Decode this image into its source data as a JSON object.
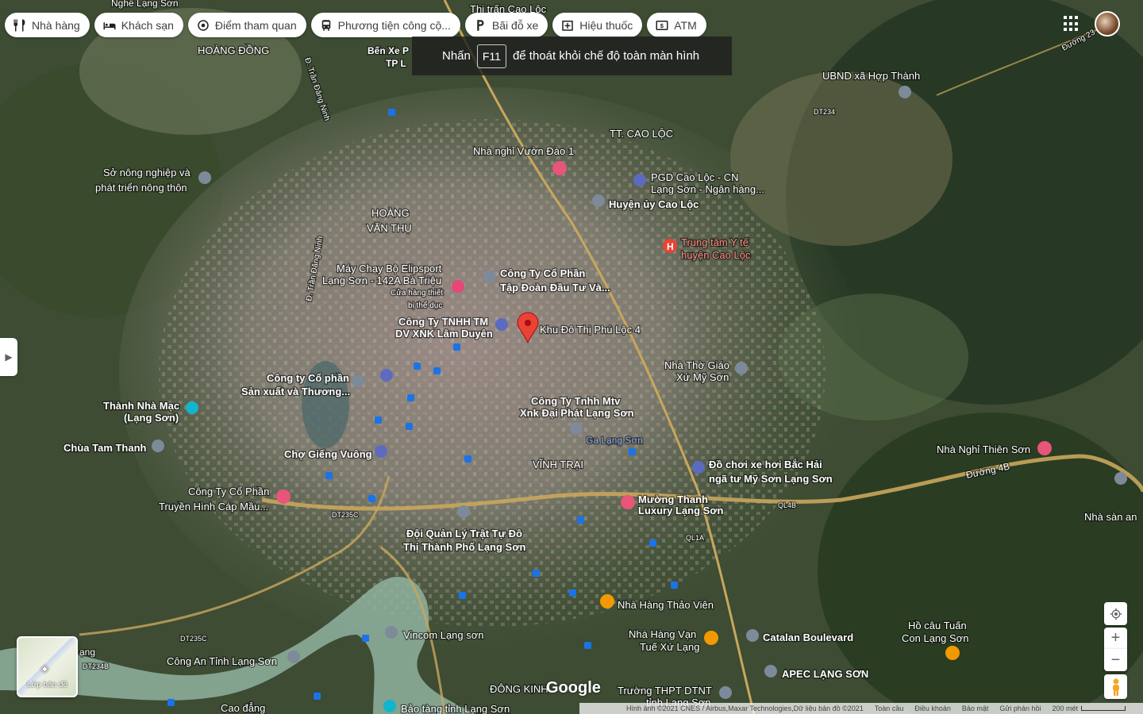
{
  "chips": [
    {
      "label": "Nhà hàng",
      "icon": "restaurant-icon"
    },
    {
      "label": "Khách sạn",
      "icon": "hotel-icon"
    },
    {
      "label": "Điểm tham quan",
      "icon": "attraction-icon"
    },
    {
      "label": "Phương tiện công cộ...",
      "icon": "transit-icon"
    },
    {
      "label": "Bãi đỗ xe",
      "icon": "parking-icon"
    },
    {
      "label": "Hiệu thuốc",
      "icon": "pharmacy-icon"
    },
    {
      "label": "ATM",
      "icon": "atm-icon"
    }
  ],
  "fullscreen_notice": {
    "prefix": "Nhấn",
    "key": "F11",
    "suffix": "để thoát khỏi chế độ toàn màn hình"
  },
  "layers_button": {
    "label": "Lớp bản đồ"
  },
  "footer": {
    "imagery": "Hình ảnh ©2021 CNES / Airbus,Maxar Technologies,Dữ liệu bản đồ ©2021",
    "global": "Toàn cầu",
    "terms": "Điều khoản",
    "privacy": "Bảo mật",
    "feedback": "Gửi phản hồi",
    "scale": "200 mét"
  },
  "brand": "Google",
  "colors": {
    "road_major": "#c9a65c",
    "river": "#8fb3a0",
    "pin_red": "#ea4335",
    "hotel_pink": "#e8557a",
    "food_orange": "#f29900",
    "poi_gray": "#7c8a9a",
    "transit_blue": "#1a73e8",
    "poi_teal": "#12b5cb"
  },
  "map_labels": [
    {
      "text": "Nghề Lạng Sơn",
      "kind": "area"
    },
    {
      "text": "Thị trấn Cao Lộc",
      "kind": "area"
    },
    {
      "text": "HOÀNG ĐỒNG",
      "kind": "district"
    },
    {
      "text": "Bến Xe Phía Bắc TP Lạng Sơn",
      "kind": "place"
    },
    {
      "text": "Đường 23",
      "kind": "road"
    },
    {
      "text": "UBND xã Hợp Thành",
      "kind": "place"
    },
    {
      "text": "DT234",
      "kind": "shield"
    },
    {
      "text": "TT. CAO LỘC",
      "kind": "district"
    },
    {
      "text": "Nhà nghỉ Vườn Đào 1",
      "kind": "hotel"
    },
    {
      "text": "Sở nông nghiệp và phát triển nông thôn",
      "kind": "place"
    },
    {
      "text": "PGD Cao Lộc - CN Lạng Sơn - Ngân hàng...",
      "kind": "place"
    },
    {
      "text": "Huyện ủy Cao Lộc",
      "kind": "place"
    },
    {
      "text": "HOÀNG VĂN THỤ",
      "kind": "district"
    },
    {
      "text": "Trung tâm Y tế huyện Cao Lộc",
      "kind": "hospital"
    },
    {
      "text": "Máy Chạy Bộ Elipsport Lạng Sơn - 142A Bà Triệu",
      "kind": "place"
    },
    {
      "text": "Cửa hàng thiết bị thể dục",
      "kind": "small"
    },
    {
      "text": "Công Ty Cổ Phần Tập Đoàn Đầu Tư Và...",
      "kind": "place"
    },
    {
      "text": "Công Ty TNHH TM DV XNK Lâm Duyên",
      "kind": "place"
    },
    {
      "text": "Khu Đô Thị Phú Lộc 4",
      "kind": "selected"
    },
    {
      "text": "Nhà Thờ Giáo Xứ Mỹ Sơn",
      "kind": "place"
    },
    {
      "text": "Công ty Cổ phần Sản xuất và Thương...",
      "kind": "place"
    },
    {
      "text": "Công Ty Tnhh Mtv Xnk Đại Phát Lạng Sơn",
      "kind": "place"
    },
    {
      "text": "Thành Nhà Mạc (Lạng Sơn)",
      "kind": "place"
    },
    {
      "text": "Ga Lạng Sơn",
      "kind": "transit"
    },
    {
      "text": "Chùa Tam Thanh",
      "kind": "place"
    },
    {
      "text": "Chợ Giếng Vuông",
      "kind": "place"
    },
    {
      "text": "VĨNH TRẠI",
      "kind": "district"
    },
    {
      "text": "Đồ chơi xe hơi Bắc Hải ngã tư Mỹ Sơn Lạng Sơn",
      "kind": "place"
    },
    {
      "text": "Nhà Nghỉ Thiên Sơn",
      "kind": "hotel"
    },
    {
      "text": "Đường 4B",
      "kind": "road"
    },
    {
      "text": "Công Ty Cổ Phần Truyền Hình Cáp Mầu...",
      "kind": "place"
    },
    {
      "text": "DT235C",
      "kind": "shield"
    },
    {
      "text": "Mường Thanh Luxury Lạng Sơn",
      "kind": "hotel"
    },
    {
      "text": "QL4B",
      "kind": "shield"
    },
    {
      "text": "Nhà sàn an",
      "kind": "place"
    },
    {
      "text": "Đội Quản Lý Trật Tự Đô Thị Thành Phố Lạng Sơn",
      "kind": "place"
    },
    {
      "text": "QL1A",
      "kind": "shield"
    },
    {
      "text": "Nhà Hàng Thảo Viên",
      "kind": "food"
    },
    {
      "text": "DT235C",
      "kind": "shield"
    },
    {
      "text": "Vincom Lạng sơn",
      "kind": "place"
    },
    {
      "text": "Nhà Hàng Vạn Tuế Xứ Lạng",
      "kind": "food"
    },
    {
      "text": "Catalan Boulevard",
      "kind": "place"
    },
    {
      "text": "Hồ câu Tuấn Con Lạng Sơn",
      "kind": "food"
    },
    {
      "text": "DT234B",
      "kind": "shield"
    },
    {
      "text": "Công An Tỉnh Lạng Sơn",
      "kind": "place"
    },
    {
      "text": "APEC LẠNG SƠN",
      "kind": "place"
    },
    {
      "text": "ĐÔNG KINH",
      "kind": "district"
    },
    {
      "text": "Trường THPT DTNT tỉnh Lạng Sơn",
      "kind": "place"
    },
    {
      "text": "Cao đẳng",
      "kind": "place"
    },
    {
      "text": "Bảo tàng tỉnh Lạng Sơn",
      "kind": "place"
    },
    {
      "text": "Đ. Trần Đăng Ninh",
      "kind": "road"
    },
    {
      "text": "Đ. Trần Đăng Ninh",
      "kind": "road"
    },
    {
      "text": "ạng",
      "kind": "small"
    }
  ]
}
